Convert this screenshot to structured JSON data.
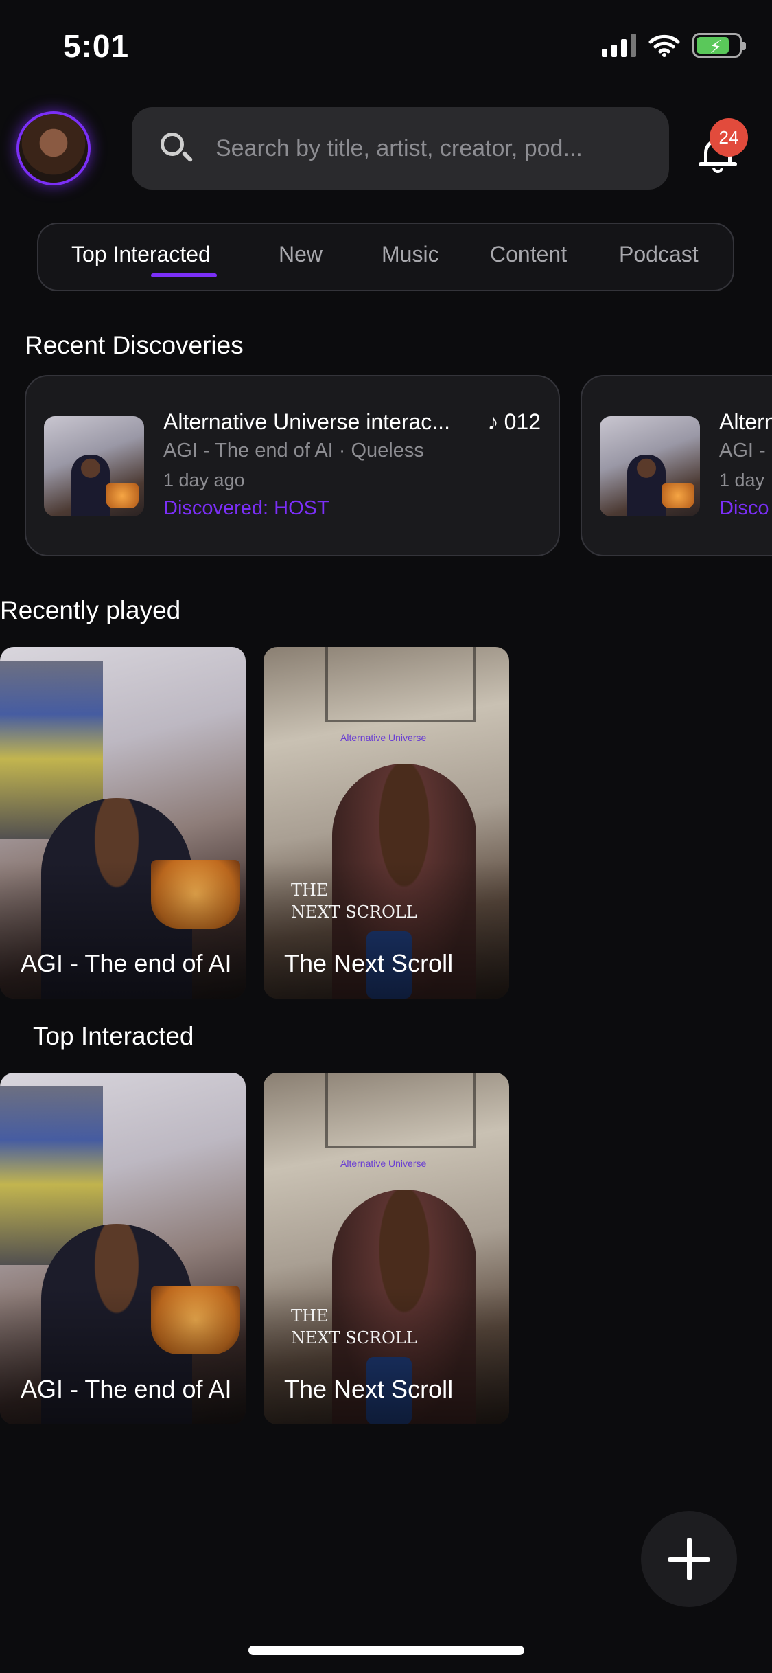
{
  "status_bar": {
    "time": "5:01",
    "icons": [
      "signal-icon",
      "wifi-icon",
      "battery-charging-icon"
    ]
  },
  "header": {
    "avatar": "user-avatar",
    "search_placeholder": "Search by title, artist, creator, pod...",
    "notification_count": "24"
  },
  "tabs": [
    {
      "label": "Top Interacted",
      "active": true
    },
    {
      "label": "New",
      "active": false
    },
    {
      "label": "Music",
      "active": false
    },
    {
      "label": "Content",
      "active": false
    },
    {
      "label": "Podcast",
      "active": false
    }
  ],
  "recent_discoveries": {
    "title": "Recent Discoveries",
    "items": [
      {
        "title": "Alternative Universe  interac...",
        "count": "012",
        "meta": "AGI - The end of AI · Queless",
        "time": "1 day ago",
        "discovered": "Discovered: HOST"
      },
      {
        "title": "Altern",
        "meta": "AGI -",
        "time": "1 day",
        "discovered": "Disco"
      }
    ]
  },
  "recently_played": {
    "title": "Recently played",
    "items": [
      {
        "title": "AGI - The end of AI"
      },
      {
        "title": "The Next Scroll",
        "overlay_line1": "THE",
        "overlay_line2": "NEXT SCROLL",
        "logo_text": "Alternative Universe"
      }
    ]
  },
  "top_interacted": {
    "title": "Top Interacted",
    "items": [
      {
        "title": "AGI - The end of AI"
      },
      {
        "title": "The Next Scroll",
        "overlay_line1": "THE",
        "overlay_line2": "NEXT SCROLL",
        "logo_text": "Alternative Universe"
      }
    ]
  },
  "accent_color": "#7b2ff7",
  "badge_color": "#e24b3c"
}
